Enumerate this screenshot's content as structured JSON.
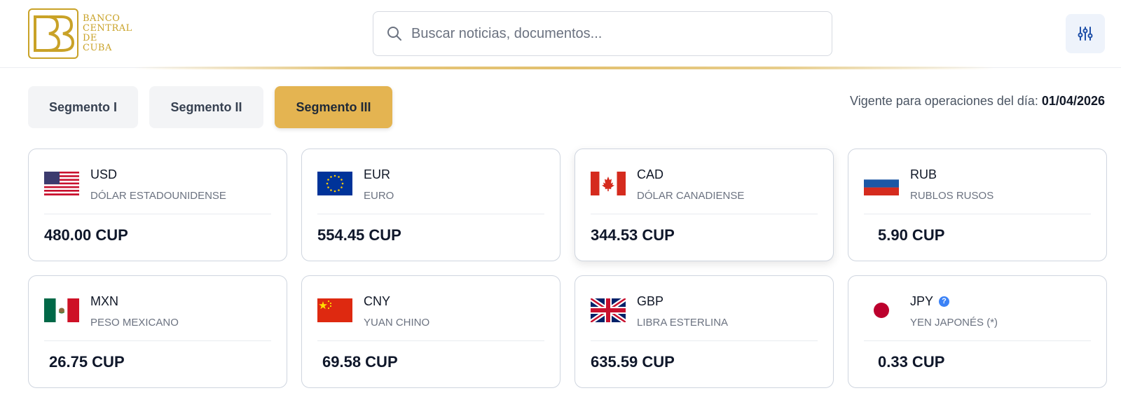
{
  "header": {
    "logo": {
      "lines": [
        "BANCO",
        "CENTRAL DE",
        "CUBA"
      ],
      "accent": "#c9a227"
    },
    "search": {
      "placeholder": "Buscar noticias, documentos..."
    },
    "filter_icon": "sliders-icon"
  },
  "tabs": [
    {
      "label": "Segmento I",
      "active": false
    },
    {
      "label": "Segmento II",
      "active": false
    },
    {
      "label": "Segmento III",
      "active": true
    }
  ],
  "validity": {
    "label": "Vigente para operaciones del día:",
    "date": "01/04/2026"
  },
  "currencies": [
    {
      "code": "USD",
      "name": "DÓLAR ESTADOUNIDENSE",
      "rate": "480.00 CUP",
      "flag": "us-flag"
    },
    {
      "code": "EUR",
      "name": "EURO",
      "rate": "554.45 CUP",
      "flag": "eu-flag"
    },
    {
      "code": "CAD",
      "name": "DÓLAR CANADIENSE",
      "rate": "344.53 CUP",
      "flag": "ca-flag"
    },
    {
      "code": "RUB",
      "name": "RUBLOS RUSOS",
      "rate": "5.90 CUP",
      "flag": "ru-flag"
    },
    {
      "code": "MXN",
      "name": "PESO MEXICANO",
      "rate": "26.75 CUP",
      "flag": "mx-flag"
    },
    {
      "code": "CNY",
      "name": "YUAN CHINO",
      "rate": "69.58 CUP",
      "flag": "cn-flag"
    },
    {
      "code": "GBP",
      "name": "LIBRA ESTERLINA",
      "rate": "635.59 CUP",
      "flag": "gb-flag"
    },
    {
      "code": "JPY",
      "name": "YEN JAPONÉS (*)",
      "rate": "0.33 CUP",
      "flag": "jp-flag",
      "help_icon": "?"
    }
  ],
  "colors": {
    "accent_gold": "#e4b451",
    "primary_blue": "#1e4fa8"
  }
}
